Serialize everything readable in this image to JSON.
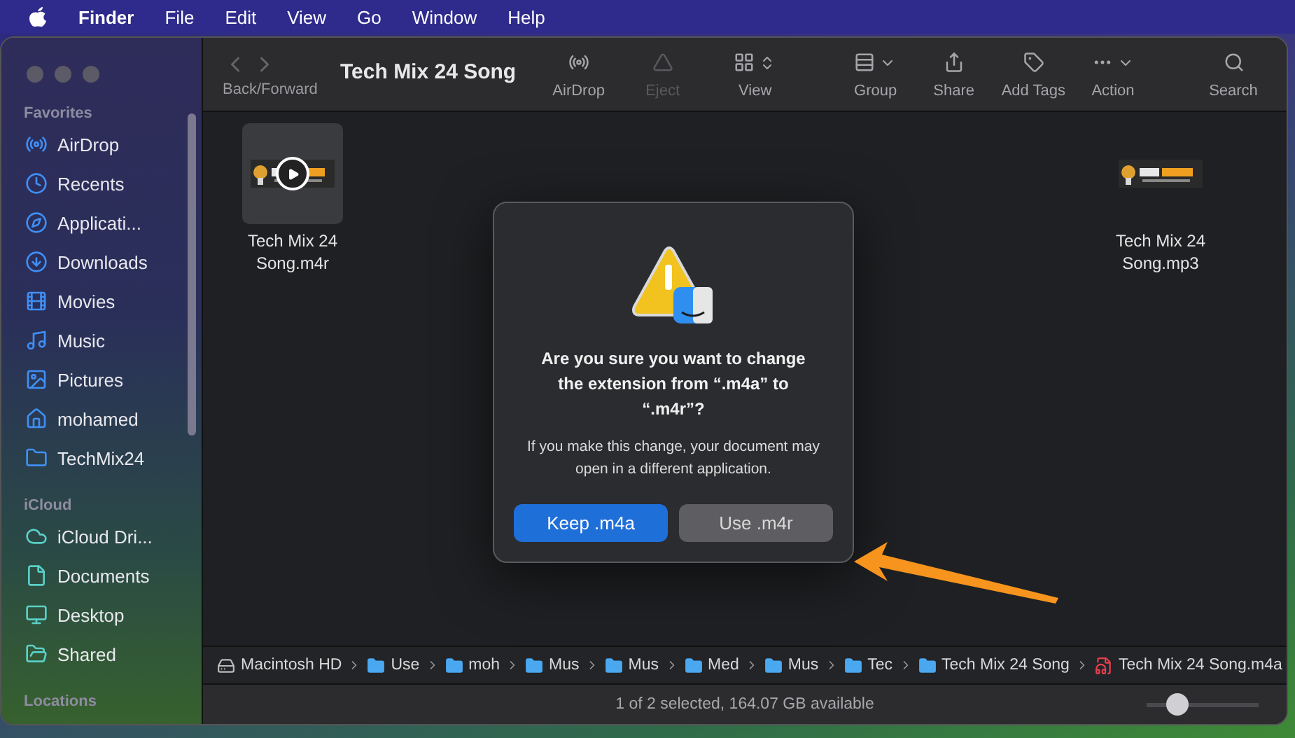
{
  "menu_bar": {
    "app": "Finder",
    "items": [
      "File",
      "Edit",
      "View",
      "Go",
      "Window",
      "Help"
    ]
  },
  "window": {
    "title": "Tech Mix 24 Song"
  },
  "toolbar": {
    "nav_label": "Back/Forward",
    "items": [
      {
        "label": "AirDrop",
        "disabled": false
      },
      {
        "label": "Eject",
        "disabled": true
      },
      {
        "label": "View",
        "disabled": false
      },
      {
        "label": "Group",
        "disabled": false
      },
      {
        "label": "Share",
        "disabled": false
      },
      {
        "label": "Add Tags",
        "disabled": false
      },
      {
        "label": "Action",
        "disabled": false
      },
      {
        "label": "Search",
        "disabled": false
      }
    ]
  },
  "sidebar": {
    "sections": [
      {
        "title": "Favorites",
        "items": [
          "AirDrop",
          "Recents",
          "Applicati...",
          "Downloads",
          "Movies",
          "Music",
          "Pictures",
          "mohamed",
          "TechMix24"
        ]
      },
      {
        "title": "iCloud",
        "items": [
          "iCloud Dri...",
          "Documents",
          "Desktop",
          "Shared"
        ]
      },
      {
        "title": "Locations"
      }
    ]
  },
  "files": [
    {
      "name": "Tech Mix 24 Song.m4r",
      "selected": true,
      "playable": true
    },
    {
      "name": "Tech Mix 24 Song.mp3",
      "selected": false,
      "playable": false
    }
  ],
  "dialog": {
    "title": "Are you sure you want to change the extension from “.m4a” to “.m4r”?",
    "message": "If you make this change, your document may open in a different application.",
    "buttons": [
      {
        "label": "Keep .m4a",
        "default": true
      },
      {
        "label": "Use .m4r",
        "default": false
      }
    ]
  },
  "path_bar": [
    {
      "label": "Macintosh HD",
      "kind": "disk"
    },
    {
      "label": "Use",
      "kind": "folder"
    },
    {
      "label": "moh",
      "kind": "folder"
    },
    {
      "label": "Mus",
      "kind": "folder"
    },
    {
      "label": "Mus",
      "kind": "folder"
    },
    {
      "label": "Med",
      "kind": "folder"
    },
    {
      "label": "Mus",
      "kind": "folder"
    },
    {
      "label": "Tec",
      "kind": "folder"
    },
    {
      "label": "Tech Mix 24 Song",
      "kind": "folder"
    },
    {
      "label": "Tech Mix 24 Song.m4a",
      "kind": "file"
    }
  ],
  "status_bar": {
    "text": "1 of 2 selected, 164.07 GB available",
    "zoom": {
      "level": 0.27
    }
  }
}
